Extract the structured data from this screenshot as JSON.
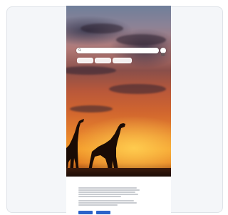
{
  "statusbar": {
    "time": "",
    "icons": ""
  },
  "search": {
    "placeholder": ""
  },
  "chips": [
    {
      "label": ""
    },
    {
      "label": ""
    },
    {
      "label": ""
    }
  ],
  "footer": {
    "heading": "",
    "primary_button": "",
    "secondary_button": "",
    "link_button": ""
  },
  "colors": {
    "accent": "#2b62c9",
    "card_background": "#f4f6f9"
  },
  "icons": {
    "search": "search-icon",
    "camera": "camera-icon"
  }
}
